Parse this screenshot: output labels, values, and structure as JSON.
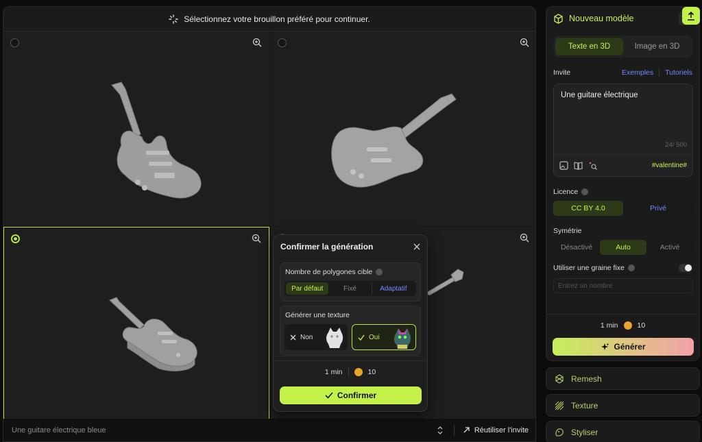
{
  "topbar": {
    "message": "Sélectionnez votre brouillon préféré pour continuer."
  },
  "bottombar": {
    "prompt_placeholder": "Une guitare électrique bleue",
    "reuse_label": "Réutiliser l'invite"
  },
  "modal": {
    "title": "Confirmer la génération",
    "polycount_label": "Nombre de polygones cible",
    "polycount_options": [
      "Par défaut",
      "Fixé",
      "Adaptatif"
    ],
    "polycount_selected": "Par défaut",
    "texture_label": "Générer une texture",
    "texture_no": "Non",
    "texture_yes": "Oui",
    "texture_selected": "Oui",
    "time": "1 min",
    "cost": "10",
    "confirm_label": "Confirmer"
  },
  "side": {
    "title": "Nouveau modèle",
    "tabs": [
      "Texte en 3D",
      "Image en 3D"
    ],
    "active_tab": "Texte en 3D",
    "prompt_label": "Invite",
    "examples_link": "Exemples",
    "tutorials_link": "Tutoriels",
    "prompt_value": "Une guitare électrique",
    "counter": "24/ 500",
    "hashtag": "#valentine#",
    "license_label": "Licence",
    "license_options": [
      "CC BY 4.0",
      "Privé"
    ],
    "license_selected": "CC BY 4.0",
    "symmetry_label": "Symétrie",
    "symmetry_options": [
      "Désactivé",
      "Auto",
      "Activé"
    ],
    "symmetry_selected": "Auto",
    "seed_label": "Utiliser une graine fixe",
    "seed_enabled": false,
    "seed_placeholder": "Entrez un nombre",
    "time": "1 min",
    "cost": "10",
    "generate_label": "Générer"
  },
  "tools": [
    {
      "label": "Remesh",
      "icon": "remesh-icon"
    },
    {
      "label": "Texture",
      "icon": "texture-icon"
    },
    {
      "label": "Styliser",
      "icon": "stylize-icon"
    }
  ],
  "drafts": {
    "selected_index": 3
  },
  "colors": {
    "accent": "#c4f04a",
    "link": "#6f8cff",
    "panel": "#1b1b1b",
    "background": "#0c0c0c"
  }
}
